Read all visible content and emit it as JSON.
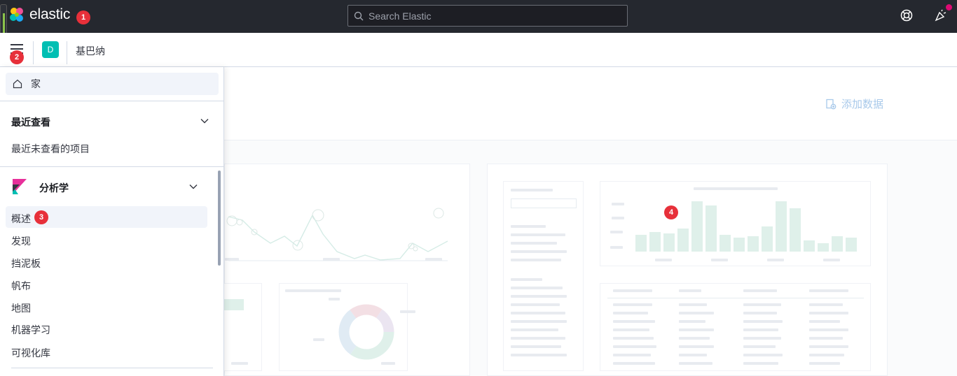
{
  "header": {
    "brand": "elastic",
    "search_placeholder": "Search Elastic"
  },
  "subbar": {
    "space_initial": "D",
    "breadcrumb": "基巴纳"
  },
  "nav": {
    "home_label": "家",
    "recent": {
      "title": "最近查看",
      "empty_text": "最近未查看的项目"
    },
    "analytics": {
      "title": "分析学",
      "items": [
        "概述",
        "发现",
        "挡泥板",
        "帆布",
        "地图",
        "机器学习",
        "可视化库"
      ]
    }
  },
  "main": {
    "add_data_label": "添加数据"
  },
  "annotations": {
    "badge_1": "1",
    "badge_2": "2",
    "badge_3": "3",
    "badge_4": "4"
  },
  "colors": {
    "topbar_bg": "#25282f",
    "accent_teal": "#00bfb3",
    "badge_red": "#e7303a",
    "link_blue": "#a8c9ea"
  }
}
